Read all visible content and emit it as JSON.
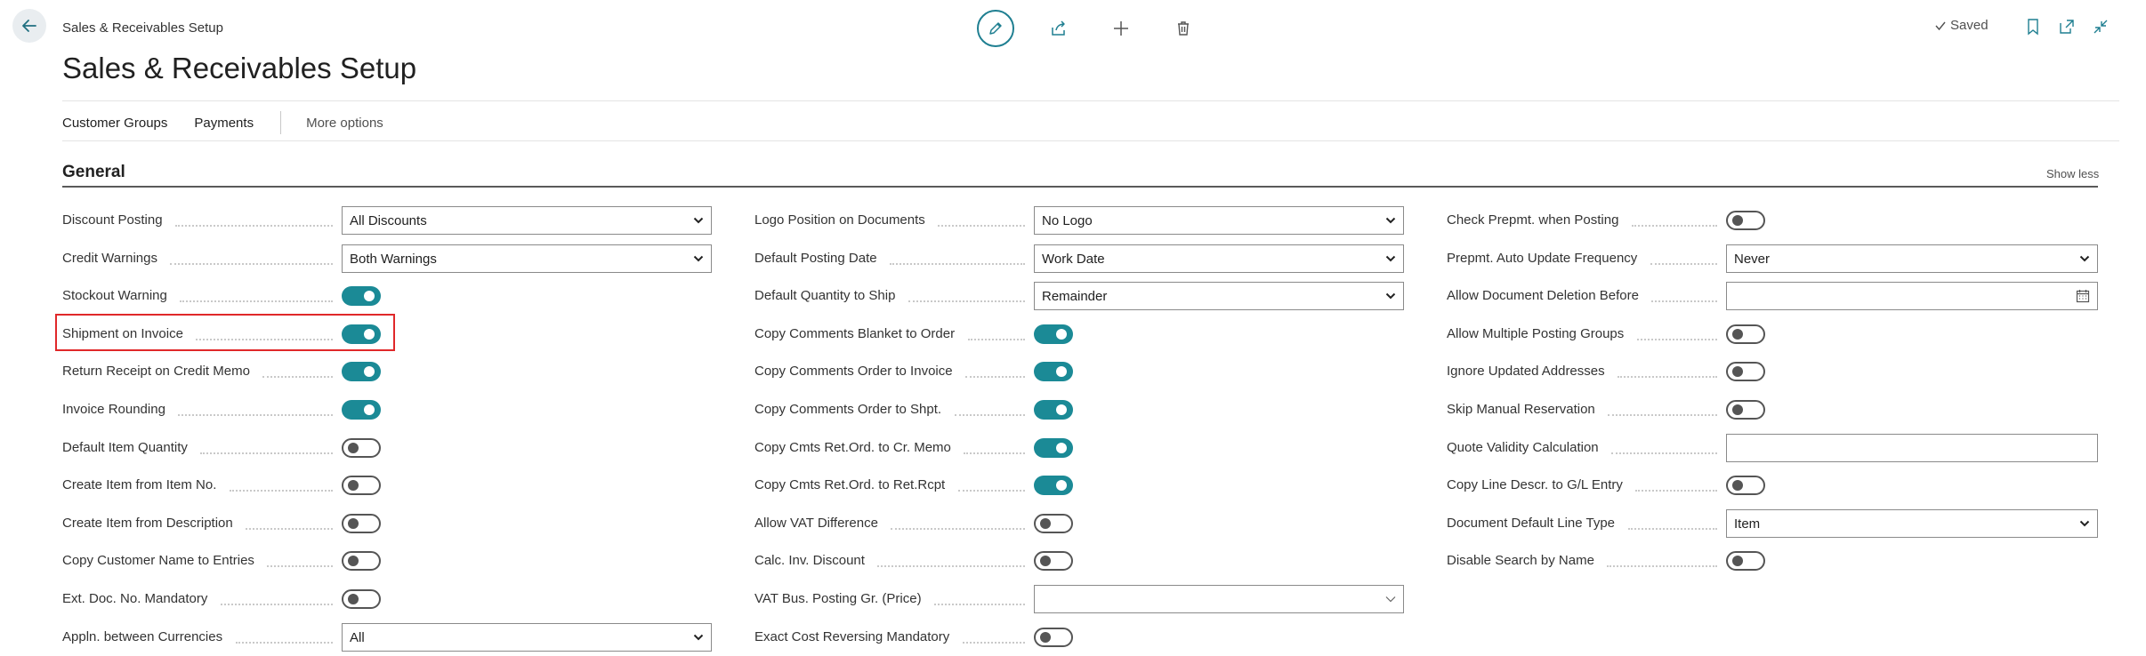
{
  "header": {
    "breadcrumb": "Sales & Receivables Setup",
    "title": "Sales & Receivables Setup",
    "status": "Saved"
  },
  "actions": {
    "items": [
      "Customer Groups",
      "Payments"
    ],
    "more": "More options"
  },
  "section": {
    "title": "General",
    "toggle_label": "Show less"
  },
  "colors": {
    "accent": "#1b8a96",
    "highlight": "#e0282a"
  },
  "col1": [
    {
      "label": "Discount Posting",
      "type": "select",
      "value": "All Discounts"
    },
    {
      "label": "Credit Warnings",
      "type": "select",
      "value": "Both Warnings"
    },
    {
      "label": "Stockout Warning",
      "type": "toggle",
      "value": true
    },
    {
      "label": "Shipment on Invoice",
      "type": "toggle",
      "value": true
    },
    {
      "label": "Return Receipt on Credit Memo",
      "type": "toggle",
      "value": true
    },
    {
      "label": "Invoice Rounding",
      "type": "toggle",
      "value": true
    },
    {
      "label": "Default Item Quantity",
      "type": "toggle",
      "value": false
    },
    {
      "label": "Create Item from Item No.",
      "type": "toggle",
      "value": false
    },
    {
      "label": "Create Item from Description",
      "type": "toggle",
      "value": false
    },
    {
      "label": "Copy Customer Name to Entries",
      "type": "toggle",
      "value": false
    },
    {
      "label": "Ext. Doc. No. Mandatory",
      "type": "toggle",
      "value": false
    },
    {
      "label": "Appln. between Currencies",
      "type": "select",
      "value": "All"
    }
  ],
  "col2": [
    {
      "label": "Logo Position on Documents",
      "type": "select",
      "value": "No Logo"
    },
    {
      "label": "Default Posting Date",
      "type": "select",
      "value": "Work Date"
    },
    {
      "label": "Default Quantity to Ship",
      "type": "select",
      "value": "Remainder"
    },
    {
      "label": "Copy Comments Blanket to Order",
      "type": "toggle",
      "value": true
    },
    {
      "label": "Copy Comments Order to Invoice",
      "type": "toggle",
      "value": true
    },
    {
      "label": "Copy Comments Order to Shpt.",
      "type": "toggle",
      "value": true
    },
    {
      "label": "Copy Cmts Ret.Ord. to Cr. Memo",
      "type": "toggle",
      "value": true
    },
    {
      "label": "Copy Cmts Ret.Ord. to Ret.Rcpt",
      "type": "toggle",
      "value": true
    },
    {
      "label": "Allow VAT Difference",
      "type": "toggle",
      "value": false
    },
    {
      "label": "Calc. Inv. Discount",
      "type": "toggle",
      "value": false
    },
    {
      "label": "VAT Bus. Posting Gr. (Price)",
      "type": "lookup",
      "value": ""
    },
    {
      "label": "Exact Cost Reversing Mandatory",
      "type": "toggle",
      "value": false
    }
  ],
  "col3": [
    {
      "label": "Check Prepmt. when Posting",
      "type": "toggle",
      "value": false
    },
    {
      "label": "Prepmt. Auto Update Frequency",
      "type": "select",
      "value": "Never"
    },
    {
      "label": "Allow Document Deletion Before",
      "type": "date",
      "value": ""
    },
    {
      "label": "Allow Multiple Posting Groups",
      "type": "toggle",
      "value": false
    },
    {
      "label": "Ignore Updated Addresses",
      "type": "toggle",
      "value": false
    },
    {
      "label": "Skip Manual Reservation",
      "type": "toggle",
      "value": false
    },
    {
      "label": "Quote Validity Calculation",
      "type": "text",
      "value": ""
    },
    {
      "label": "Copy Line Descr. to G/L Entry",
      "type": "toggle",
      "value": false
    },
    {
      "label": "Document Default Line Type",
      "type": "select",
      "value": "Item"
    },
    {
      "label": "Disable Search by Name",
      "type": "toggle",
      "value": false
    }
  ]
}
